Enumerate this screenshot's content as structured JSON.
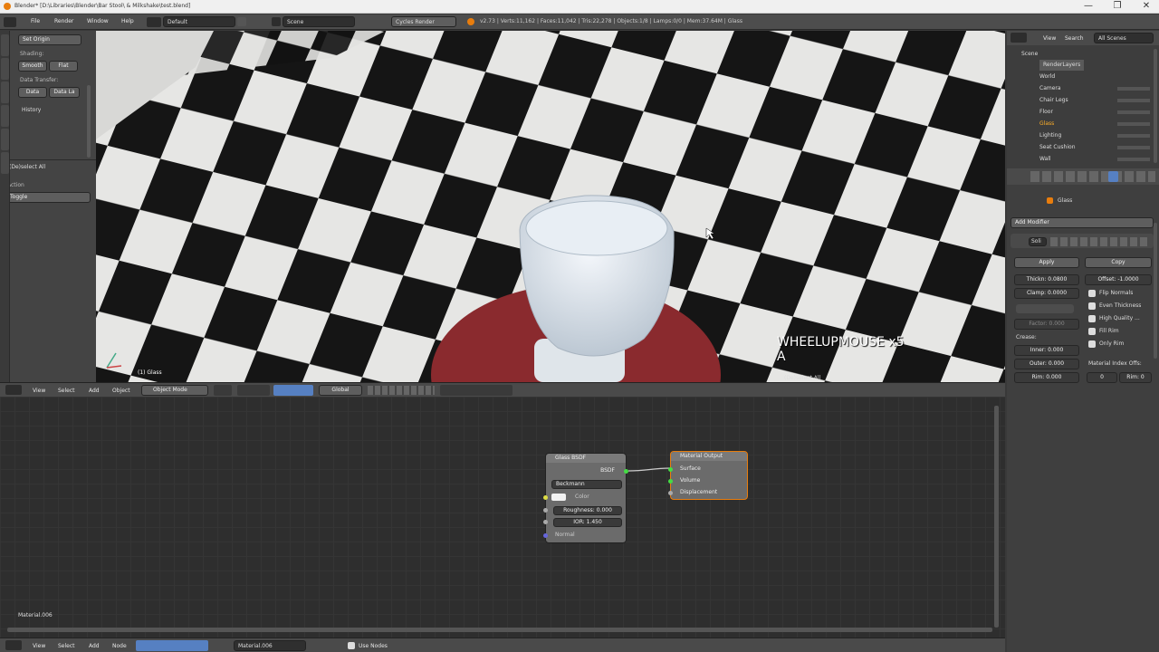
{
  "window": {
    "title": "Blender* [D:\\Libraries\\Blender\\Bar Stool\\ & Milkshake\\test.blend]",
    "min": "—",
    "max": "❐",
    "close": "✕"
  },
  "topbar": {
    "menus": [
      "File",
      "Render",
      "Window",
      "Help"
    ],
    "layout": "Default",
    "scene": "Scene",
    "engine": "Cycles Render",
    "stats": "v2.73 | Verts:11,162 | Faces:11,042 | Tris:22,278 | Objects:1/8 | Lamps:0/0 | Mem:37.64M | Glass"
  },
  "tools": {
    "set_origin": "Set Origin",
    "shading_label": "Shading:",
    "smooth": "Smooth",
    "flat": "Flat",
    "data_transfer_label": "Data Transfer:",
    "data": "Data",
    "data_layers": "Data La",
    "history": "History",
    "op_title": "(De)select All",
    "action_label": "Action",
    "action_value": "Toggle"
  },
  "viewport": {
    "overlay1": "WHEELUPMOUSE x5",
    "overlay2": "A",
    "object_label": "(1) Glass",
    "corner": "(De)select All"
  },
  "vphead": {
    "items": [
      "View",
      "Select",
      "Add",
      "Object"
    ],
    "mode": "Object Mode",
    "orientation": "Global"
  },
  "outliner": {
    "menus": [
      "View",
      "Search",
      "All Scenes"
    ],
    "rows": [
      "Scene",
      "RenderLayers",
      "World",
      "Camera",
      "Chair Legs",
      "Floor",
      "Glass",
      "Lighting",
      "Seat Cushion",
      "Wall"
    ]
  },
  "props": {
    "object": "Glass",
    "add_modifier": "Add Modifier",
    "mod_name": "Soli",
    "apply": "Apply",
    "copy": "Copy",
    "thickness": "Thickn: 0.0800",
    "offset": "Offset: -1.0000",
    "clamp": "Clamp: 0.0000",
    "flip_normals": "Flip Normals",
    "even_thickness": "Even Thickness",
    "high_quality": "High Quality ...",
    "fill_rim": "Fill Rim",
    "only_rim": "Only Rim",
    "factor": "Factor: 0.000",
    "crease": "Crease:",
    "inner": "Inner:",
    "inner_v": "0.000",
    "outer": "Outer:",
    "outer_v": "0.000",
    "rim": "Rim:",
    "rim_v": "0.000",
    "matidx": "Material Index Offs:",
    "mat0": "0",
    "rim_idx": "Rim: 0"
  },
  "nodes": {
    "glass": {
      "title": "Glass BSDF",
      "out": "BSDF",
      "dist": "Beckmann",
      "color": "Color",
      "roughness": "Roughness: 0.000",
      "ior": "IOR: 1.450",
      "normal": "Normal"
    },
    "output": {
      "title": "Material Output",
      "surface": "Surface",
      "volume": "Volume",
      "displacement": "Displacement"
    },
    "material_label": "Material.006"
  },
  "nehead": {
    "items": [
      "View",
      "Select",
      "Add",
      "Node"
    ],
    "material": "Material.006",
    "use_nodes": "Use Nodes"
  },
  "colors": {
    "accent": "#e87d0d",
    "blue": "#5680c2"
  }
}
